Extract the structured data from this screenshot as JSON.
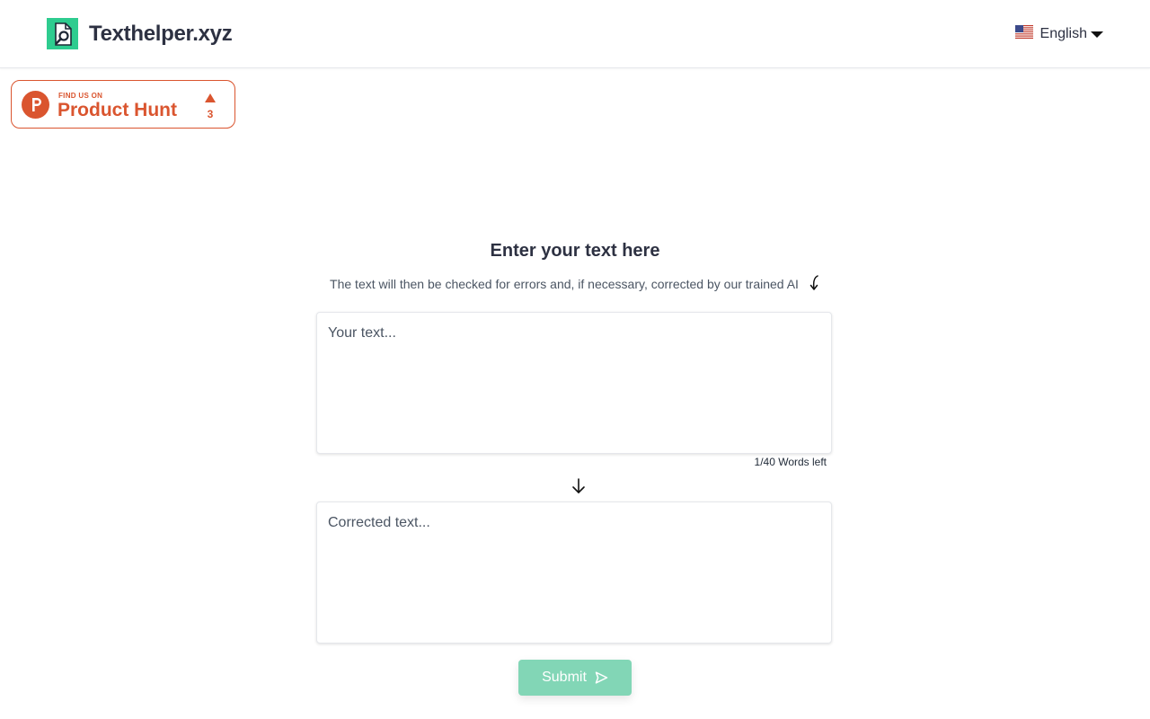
{
  "header": {
    "site_name": "Texthelper.xyz",
    "language": {
      "label": "English",
      "flag_icon": "us-flag-icon",
      "dropdown_icon": "caret-down-icon"
    }
  },
  "product_hunt": {
    "small_label": "FIND US ON",
    "big_label": "Product Hunt",
    "vote_count": "3",
    "color": "#da552f"
  },
  "main": {
    "title": "Enter your text here",
    "subtitle": "The text will then be checked for errors and, if necessary, corrected by our trained AI",
    "input_placeholder": "Your text...",
    "word_counter": "1/40 Words left",
    "output_placeholder": "Corrected text...",
    "submit_label": "Submit"
  },
  "colors": {
    "brand_green": "#2ecc8f",
    "submit_disabled": "#82d6b6",
    "text_dark": "#2d3142"
  }
}
